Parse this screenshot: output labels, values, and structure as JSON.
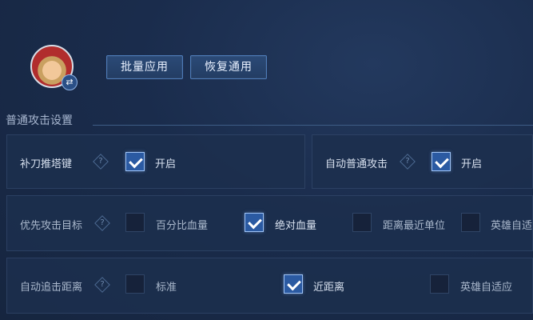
{
  "top_buttons": {
    "apply_all": "批量应用",
    "restore_default": "恢复通用"
  },
  "section": {
    "title": "普通攻击设置"
  },
  "rows": {
    "last_hit": {
      "label": "补刀推塔键",
      "help": "?",
      "option": "开启",
      "checked": true
    },
    "auto_attack": {
      "label": "自动普通攻击",
      "help": "?",
      "option": "开启",
      "checked": true
    },
    "priority": {
      "label": "优先攻击目标",
      "help": "?",
      "options": [
        {
          "label": "百分比血量",
          "checked": false
        },
        {
          "label": "绝对血量",
          "checked": true
        },
        {
          "label": "距离最近单位",
          "checked": false
        },
        {
          "label": "英雄自适",
          "checked": false
        }
      ]
    },
    "chase": {
      "label": "自动追击距离",
      "help": "?",
      "options": [
        {
          "label": "标准",
          "checked": false
        },
        {
          "label": "近距离",
          "checked": true
        },
        {
          "label": "英雄自适应",
          "checked": false
        }
      ]
    }
  },
  "colors": {
    "background": "#1a2c4c",
    "checked": "#2b5aa2",
    "button_border": "#4d7bb8"
  },
  "icons": {
    "avatar_switch": "swap-icon"
  }
}
